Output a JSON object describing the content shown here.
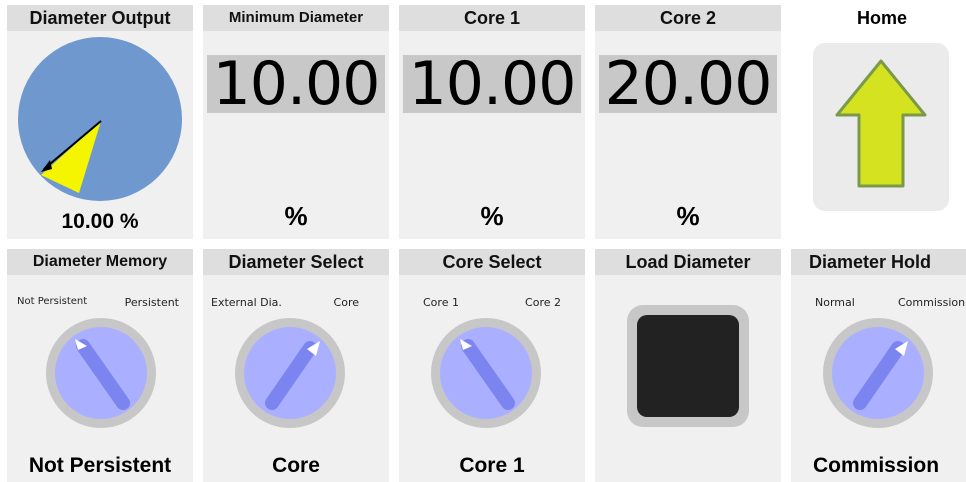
{
  "diameter_output": {
    "title": "Diameter Output",
    "value_text": "10.00 %",
    "value_percent": 10.0
  },
  "minimum_diameter": {
    "title": "Minimum Diameter",
    "value": "10.00",
    "unit": "%"
  },
  "core1": {
    "title": "Core 1",
    "value": "10.00",
    "unit": "%"
  },
  "core2": {
    "title": "Core 2",
    "value": "20.00",
    "unit": "%"
  },
  "home": {
    "title": "Home",
    "icon": "up-arrow-icon",
    "arrow_color": "#d4e21f"
  },
  "diameter_memory": {
    "title": "Diameter Memory",
    "left_label": "Not Persistent",
    "right_label": "Persistent",
    "state": "Not Persistent"
  },
  "diameter_select": {
    "title": "Diameter Select",
    "left_label": "External Dia.",
    "right_label": "Core",
    "state": "Core"
  },
  "core_select": {
    "title": "Core Select",
    "left_label": "Core 1",
    "right_label": "Core 2",
    "state": "Core 1"
  },
  "load_diameter": {
    "title": "Load Diameter",
    "button_color": "#222222"
  },
  "diameter_hold": {
    "title": "Diameter Hold",
    "left_label": "Normal",
    "right_label": "Commission",
    "state": "Commission"
  },
  "colors": {
    "gauge_fill": "#6f98cf",
    "needle_fill": "#f5f500",
    "knob_fill": "#aab0ff",
    "knob_bezel": "#c7c7c7",
    "knob_lever": "#7c84f0"
  }
}
